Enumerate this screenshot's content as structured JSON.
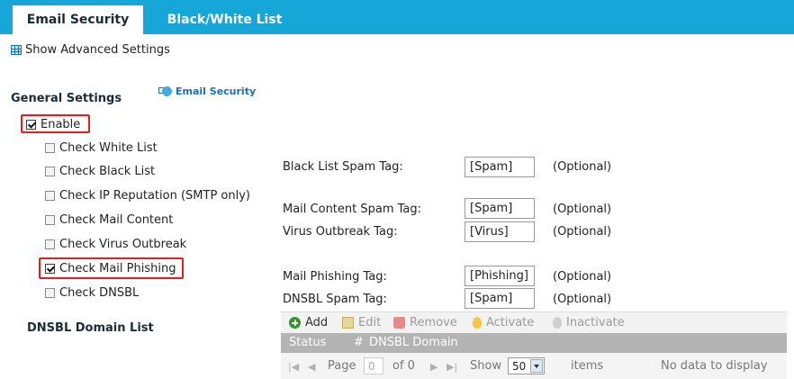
{
  "tabs": [
    {
      "label": "Email Security"
    },
    {
      "label": "Black/White List"
    }
  ],
  "advanced_link": "Show Advanced Settings",
  "general": {
    "title": "General Settings",
    "help_link": "Email Security"
  },
  "enable": {
    "label": "Enable",
    "checked": true
  },
  "checks": [
    {
      "label": "Check White List",
      "checked": false
    },
    {
      "label": "Check Black List",
      "checked": false
    },
    {
      "label": "Check IP Reputation (SMTP only)",
      "checked": false
    },
    {
      "label": "Check Mail Content",
      "checked": false
    },
    {
      "label": "Check Virus Outbreak",
      "checked": false
    },
    {
      "label": "Check Mail Phishing",
      "checked": true
    },
    {
      "label": "Check DNSBL",
      "checked": false
    }
  ],
  "tags": {
    "black_list": {
      "label": "Black List Spam Tag:",
      "value": "[Spam]",
      "optional": "(Optional)"
    },
    "mail_content": {
      "label": "Mail Content Spam Tag:",
      "value": "[Spam]",
      "optional": "(Optional)"
    },
    "virus": {
      "label": "Virus Outbreak Tag:",
      "value": "[Virus]",
      "optional": "(Optional)"
    },
    "phishing": {
      "label": "Mail Phishing Tag:",
      "value": "[Phishing]",
      "optional": "(Optional)"
    },
    "dnsbl": {
      "label": "DNSBL Spam Tag:",
      "value": "[Spam]",
      "optional": "(Optional)"
    }
  },
  "dnsbl": {
    "title": "DNSBL Domain List",
    "toolbar": {
      "add": "Add",
      "edit": "Edit",
      "remove": "Remove",
      "activate": "Activate",
      "inactivate": "Inactivate"
    },
    "columns": {
      "status": "Status",
      "number": "#",
      "domain": "DNSBL Domain"
    },
    "pager": {
      "page_label": "Page",
      "page_value": "0",
      "of_label": "of 0",
      "show_label": "Show",
      "show_value": "50",
      "items_label": "items",
      "empty_text": "No data to display"
    }
  },
  "colors": {
    "tab_bar": "#16a6d8",
    "highlight": "#e02020",
    "header": "#b3b3b3"
  }
}
